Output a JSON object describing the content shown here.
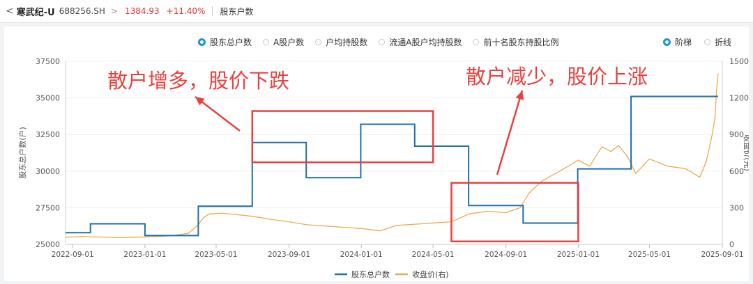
{
  "header": {
    "back_symbol": "<",
    "stock_name": "寒武纪-U",
    "stock_code": "688256.SH",
    "chevron": ">",
    "price": "1384.93",
    "change_pct": "+11.40%",
    "page_title": "股东户数"
  },
  "tabs": [
    {
      "label": "股东总户数",
      "selected": true
    },
    {
      "label": "A股户数",
      "selected": false
    },
    {
      "label": "户均持股数",
      "selected": false
    },
    {
      "label": "流通A股户均持股数",
      "selected": false
    },
    {
      "label": "前十名股东持股比例",
      "selected": false
    }
  ],
  "modes": [
    {
      "label": "阶梯",
      "selected": true
    },
    {
      "label": "折线",
      "selected": false
    }
  ],
  "colors": {
    "holders_line": "#1f6fa8",
    "price_line": "#f0a84f",
    "annotation": "#e8413f",
    "accent": "#1c95c8",
    "up": "#e93030"
  },
  "chart_data": {
    "type": "line",
    "x_ticks": [
      "2022-09-01",
      "2023-01-01",
      "2023-05-01",
      "2023-09-01",
      "2024-01-01",
      "2024-05-01",
      "2024-09-01",
      "2025-01-01",
      "2025-05-01",
      "2025-09-01"
    ],
    "xlim": [
      "2022-08-20",
      "2025-09-01"
    ],
    "y_left": {
      "label": "股东总户数(户)",
      "lim": [
        25000,
        37500
      ],
      "ticks": [
        25000,
        27500,
        30000,
        32500,
        35000,
        37500
      ]
    },
    "y_right": {
      "label": "收盘价(元)",
      "lim": [
        0,
        1500
      ],
      "ticks": [
        0,
        300,
        600,
        900,
        1200,
        1500
      ]
    },
    "series": [
      {
        "name": "股东总户数",
        "axis": "left",
        "step": true,
        "points": [
          [
            "2022-08-20",
            25800
          ],
          [
            "2022-10-01",
            26400
          ],
          [
            "2023-01-01",
            25600
          ],
          [
            "2023-04-01",
            27600
          ],
          [
            "2023-07-01",
            31950
          ],
          [
            "2023-09-30",
            29550
          ],
          [
            "2023-12-31",
            33200
          ],
          [
            "2024-03-31",
            31700
          ],
          [
            "2024-06-30",
            27650
          ],
          [
            "2024-09-30",
            26450
          ],
          [
            "2024-12-31",
            30150
          ],
          [
            "2025-03-31",
            35100
          ],
          [
            "2025-08-25",
            35100
          ]
        ]
      },
      {
        "name": "收盘价(右)",
        "axis": "right",
        "step": false,
        "points": [
          [
            "2022-08-20",
            58
          ],
          [
            "2022-09-15",
            64
          ],
          [
            "2022-10-15",
            60
          ],
          [
            "2022-11-15",
            55
          ],
          [
            "2022-12-15",
            58
          ],
          [
            "2023-01-15",
            62
          ],
          [
            "2023-02-15",
            70
          ],
          [
            "2023-03-15",
            90
          ],
          [
            "2023-04-01",
            160
          ],
          [
            "2023-04-10",
            220
          ],
          [
            "2023-04-20",
            250
          ],
          [
            "2023-05-10",
            255
          ],
          [
            "2023-06-01",
            245
          ],
          [
            "2023-07-01",
            230
          ],
          [
            "2023-08-01",
            205
          ],
          [
            "2023-09-01",
            185
          ],
          [
            "2023-10-01",
            160
          ],
          [
            "2023-11-01",
            150
          ],
          [
            "2023-12-01",
            140
          ],
          [
            "2024-01-01",
            130
          ],
          [
            "2024-02-01",
            110
          ],
          [
            "2024-03-01",
            155
          ],
          [
            "2024-04-01",
            165
          ],
          [
            "2024-05-01",
            175
          ],
          [
            "2024-06-01",
            185
          ],
          [
            "2024-07-01",
            250
          ],
          [
            "2024-08-01",
            270
          ],
          [
            "2024-09-01",
            260
          ],
          [
            "2024-09-25",
            300
          ],
          [
            "2024-10-10",
            420
          ],
          [
            "2024-11-01",
            520
          ],
          [
            "2024-12-01",
            600
          ],
          [
            "2025-01-01",
            690
          ],
          [
            "2025-01-20",
            640
          ],
          [
            "2025-02-10",
            800
          ],
          [
            "2025-02-25",
            760
          ],
          [
            "2025-03-10",
            810
          ],
          [
            "2025-03-25",
            720
          ],
          [
            "2025-04-08",
            580
          ],
          [
            "2025-05-01",
            700
          ],
          [
            "2025-06-01",
            640
          ],
          [
            "2025-07-01",
            620
          ],
          [
            "2025-07-25",
            550
          ],
          [
            "2025-08-05",
            680
          ],
          [
            "2025-08-15",
            900
          ],
          [
            "2025-08-20",
            1050
          ],
          [
            "2025-08-22",
            1250
          ],
          [
            "2025-08-25",
            1400
          ]
        ]
      }
    ],
    "legend": {
      "position": "bottom",
      "items": [
        "股东总户数",
        "收盘价(右)"
      ]
    },
    "annotations": [
      {
        "text": "散户增多，股价下跌",
        "date_range": [
          "2023-07-01",
          "2024-05-01"
        ],
        "holders_range": [
          30600,
          34100
        ]
      },
      {
        "text": "散户减少，股价上涨",
        "date_range": [
          "2024-06-01",
          "2025-01-01"
        ],
        "holders_range": [
          25200,
          29200
        ]
      }
    ]
  }
}
